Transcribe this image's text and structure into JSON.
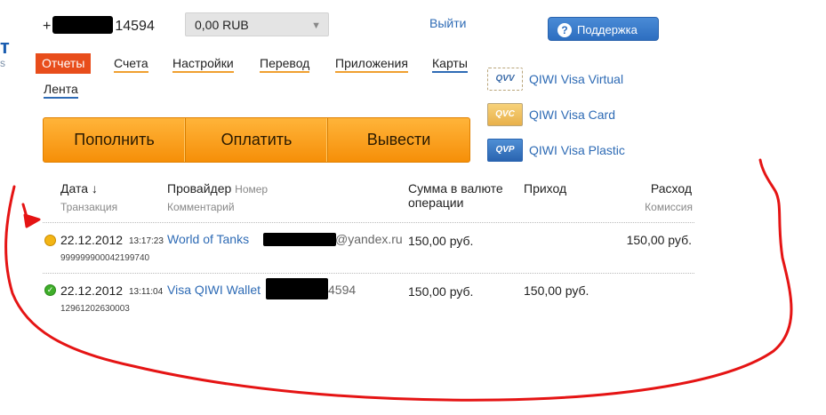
{
  "header": {
    "logo_fragment": "т",
    "logo_fragment_sub": "s",
    "phone_prefix": "+",
    "phone_suffix": "14594",
    "balance": "0,00 RUB",
    "logout": "Выйти",
    "support": "Поддержка"
  },
  "menu": {
    "items": [
      "Отчеты",
      "Счета",
      "Настройки",
      "Перевод",
      "Приложения",
      "Карты",
      "Лента"
    ]
  },
  "actions": {
    "buttons": [
      "Пополнить",
      "Оплатить",
      "Вывести"
    ]
  },
  "cards": [
    {
      "code": "QVV",
      "label": "QIWI Visa Virtual"
    },
    {
      "code": "QVC",
      "label": "QIWI Visa Card"
    },
    {
      "code": "QVP",
      "label": "QIWI Visa Plastic"
    }
  ],
  "table": {
    "headers": {
      "date": "Дата ↓",
      "date_sub": "Транзакция",
      "provider": "Провайдер",
      "provider_number": "Номер",
      "provider_sub": "Комментарий",
      "amount_line1": "Сумма в валюте",
      "amount_line2": "операции",
      "income": "Приход",
      "expense": "Расход",
      "expense_sub": "Комиссия"
    },
    "rows": [
      {
        "status": "pending",
        "date": "22.12.2012",
        "time": "13:17:23",
        "txid": "999999900042199740",
        "provider": "World of Tanks",
        "number_visible": "@yandex.ru",
        "amount": "150,00 руб.",
        "income": "",
        "expense": "150,00 руб."
      },
      {
        "status": "success",
        "date": "22.12.2012",
        "time": "13:11:04",
        "txid": "12961202630003",
        "provider": "Visa QIWI Wallet",
        "number_visible": "4594",
        "amount": "150,00 руб.",
        "income": "150,00 руб.",
        "expense": ""
      }
    ]
  },
  "colors": {
    "accent_red": "#e84d1b",
    "link_blue": "#2e6bb5",
    "button_orange": "#f68f08",
    "annotation_red": "#e51414"
  }
}
